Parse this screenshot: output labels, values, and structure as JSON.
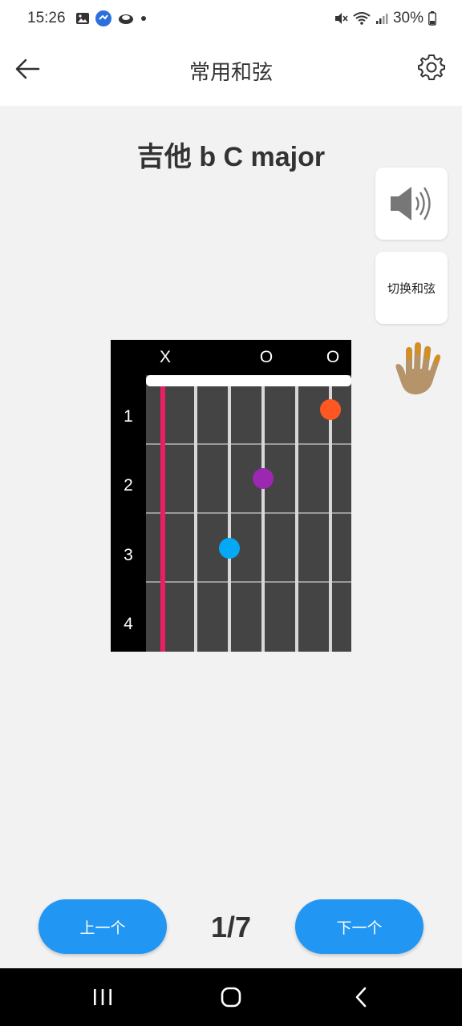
{
  "status": {
    "time": "15:26",
    "battery": "30%"
  },
  "header": {
    "title": "常用和弦"
  },
  "chord": {
    "title": "吉他 b  C major",
    "open_marks": [
      "X",
      "O",
      "O"
    ],
    "fret_numbers": [
      "1",
      "2",
      "3",
      "4"
    ],
    "dots": [
      {
        "string": 3,
        "fret": 3,
        "color": "#03a9f4"
      },
      {
        "string": 4,
        "fret": 2,
        "color": "#9c27b0"
      },
      {
        "string": 6,
        "fret": 1,
        "color": "#ff5722"
      }
    ],
    "muted_string_color": "#e91e63"
  },
  "side_panel": {
    "sound_icon": "speaker-icon",
    "switch_label": "切换和弦",
    "hand_icon": "hand-icon"
  },
  "footer": {
    "prev_label": "上一个",
    "next_label": "下一个",
    "page_indicator": "1/7"
  },
  "colors": {
    "accent": "#2196f3",
    "background": "#f2f2f2"
  }
}
